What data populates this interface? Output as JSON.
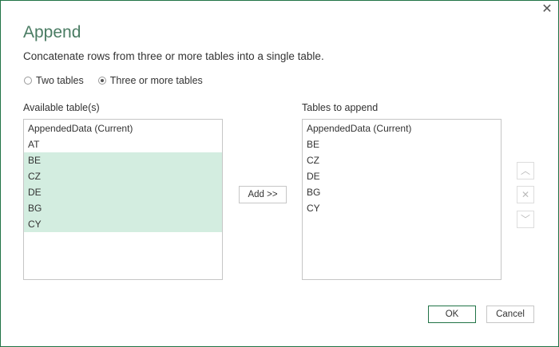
{
  "dialog": {
    "title": "Append",
    "description": "Concatenate rows from three or more tables into a single table.",
    "close_icon": "close-icon"
  },
  "mode": {
    "options": [
      "Two tables",
      "Three or more tables"
    ],
    "selected": "Three or more tables"
  },
  "available": {
    "label": "Available table(s)",
    "items": [
      "AppendedData (Current)",
      "AT",
      "BE",
      "CZ",
      "DE",
      "BG",
      "CY"
    ],
    "selected": [
      "BE",
      "CZ",
      "DE",
      "BG",
      "CY"
    ]
  },
  "add_button": "Add >>",
  "append": {
    "label": "Tables to append",
    "items": [
      "AppendedData (Current)",
      "BE",
      "CZ",
      "DE",
      "BG",
      "CY"
    ]
  },
  "side_buttons": {
    "up": "chevron-up-icon",
    "remove": "close-icon",
    "down": "chevron-down-icon"
  },
  "footer": {
    "ok": "OK",
    "cancel": "Cancel"
  },
  "colors": {
    "accent": "#217346",
    "selection": "#d3ede0"
  }
}
